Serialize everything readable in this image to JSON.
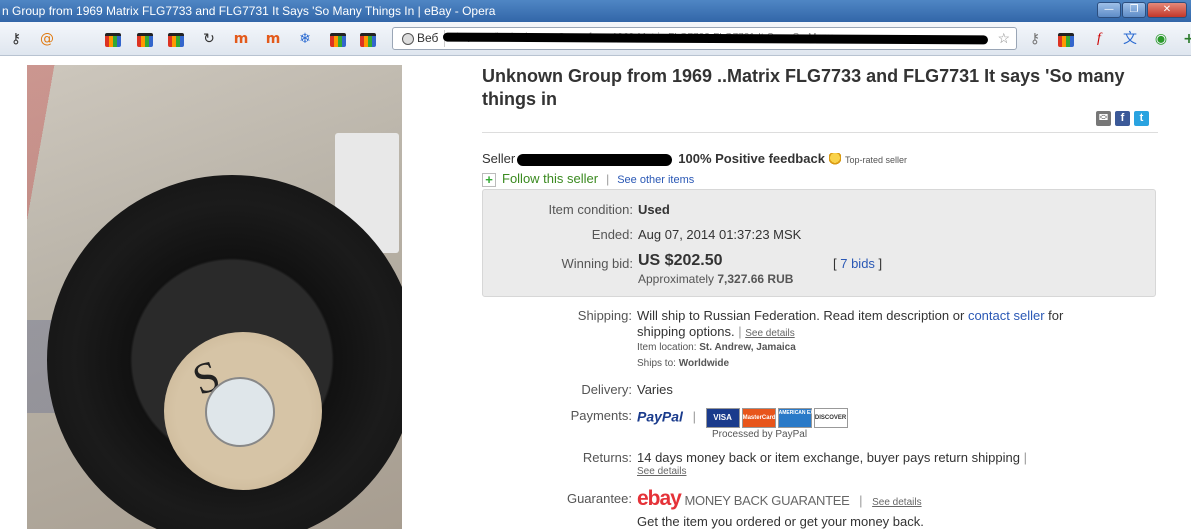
{
  "window": {
    "title": "n Group from 1969 Matrix FLG7733 and FLG7731 It Says 'So Many Things In | eBay - Opera",
    "controls": [
      "minimize",
      "restore",
      "close"
    ]
  },
  "toolbar": {
    "address_site_label": "Веб",
    "address_url": "ebay.com/itm/Unknown-Group-from-1969-Matrix-FLG7733-FLG7731-It-Says-So-Many",
    "icons": [
      "key-icon",
      "mail-icon",
      "shopping-bag-icon",
      "shopping-bag-icon",
      "shopping-bag-icon",
      "refresh-icon",
      "m-icon",
      "m-icon",
      "snowflake-icon",
      "shopping-bag-icon",
      "shopping-bag-icon",
      "bookmark-star-icon",
      "key-icon",
      "shopping-bag-icon",
      "f-icon",
      "translate-icon",
      "chrome-icon",
      "plus-icon"
    ]
  },
  "listing": {
    "title": "Unknown Group from 1969 ..Matrix FLG7733 and FLG7731 It says 'So many things in",
    "seller_label": "Seller",
    "feedback": "100% Positive feedback",
    "top_rated": "Top-rated seller",
    "follow": "Follow this seller",
    "see_other": "See other items",
    "condition_label": "Item condition:",
    "condition": "Used",
    "ended_label": "Ended:",
    "ended": "Aug 07, 2014  01:37:23 MSK",
    "winning_label": "Winning bid:",
    "winning": "US $202.50",
    "approx_prefix": "Approximately",
    "approx_value": "7,327.66 RUB",
    "bids": "7 bids",
    "shipping_label": "Shipping:",
    "shipping_text": "Will ship to Russian Federation. Read item description or",
    "contact": "contact seller",
    "shipping_text2": "for",
    "shipping_text3": "shipping options.",
    "see_details": "See details",
    "location_label": "Item location:",
    "location": "St. Andrew, Jamaica",
    "ships_label": "Ships to:",
    "ships_to": "Worldwide",
    "delivery_label": "Delivery:",
    "delivery": "Varies",
    "payments_label": "Payments:",
    "paypal": "PayPal",
    "processed": "Processed by PayPal",
    "cards": [
      "VISA",
      "MasterCard",
      "AMERICAN EXPRESS",
      "DISCOVER"
    ],
    "returns_label": "Returns:",
    "returns": "14 days money back or item exchange, buyer pays return shipping",
    "guarantee_label": "Guarantee:",
    "ebay": "ebay",
    "mbg": "MONEY BACK GUARANTEE",
    "guarantee_sub": "Get the item you ordered or get your money back."
  },
  "colors": {
    "link": "#2a58b5",
    "follow_green": "#3a8a1f",
    "title_bar": "#3f75b6"
  }
}
